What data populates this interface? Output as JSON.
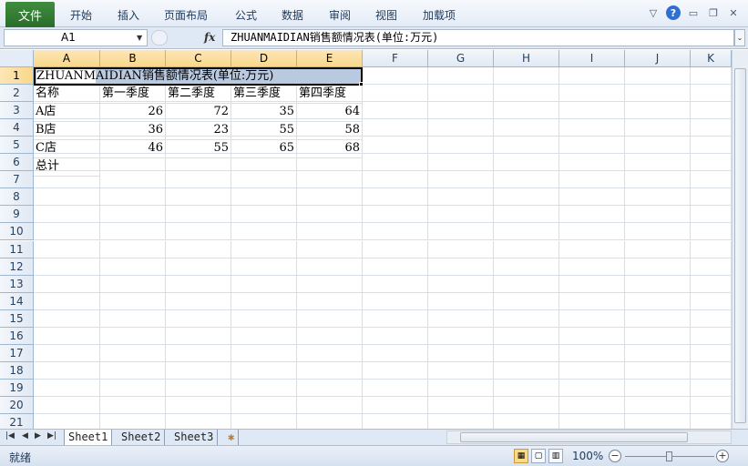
{
  "ribbon": {
    "file_tab": "文件",
    "tabs": [
      "开始",
      "插入",
      "页面布局",
      "公式",
      "数据",
      "审阅",
      "视图",
      "加载项"
    ]
  },
  "formula_bar": {
    "name_box": "A1",
    "fx_label": "fx",
    "content": "ZHUANMAIDIAN销售额情况表(单位:万元)"
  },
  "grid": {
    "columns": [
      "A",
      "B",
      "C",
      "D",
      "E",
      "F",
      "G",
      "H",
      "I",
      "J",
      "K"
    ],
    "rows": [
      "1",
      "2",
      "3",
      "4",
      "5",
      "6",
      "7",
      "8",
      "9",
      "10",
      "11",
      "12",
      "13",
      "14",
      "15",
      "16",
      "17",
      "18",
      "19",
      "20",
      "21"
    ],
    "title": "ZHUANMAIDIAN销售额情况表(单位:万元)",
    "title_visible_prefix": "ZHUANM",
    "title_rest": "AIDIAN销售额情况表(单位:万元)",
    "header_row": [
      "名称",
      "第一季度",
      "第二季度",
      "第三季度",
      "第四季度"
    ],
    "data_rows": [
      [
        "A店",
        "26",
        "72",
        "35",
        "64"
      ],
      [
        "B店",
        "36",
        "23",
        "55",
        "58"
      ],
      [
        "C店",
        "46",
        "55",
        "65",
        "68"
      ]
    ],
    "total_label": "总计"
  },
  "sheets": {
    "tabs": [
      "Sheet1",
      "Sheet2",
      "Sheet3"
    ],
    "active": "Sheet1"
  },
  "status": {
    "ready": "就绪",
    "zoom": "100%"
  },
  "colors": {
    "file_tab": "#2b6d2b",
    "selection": "#b9c9e0",
    "header_selected": "#f9d88b"
  }
}
